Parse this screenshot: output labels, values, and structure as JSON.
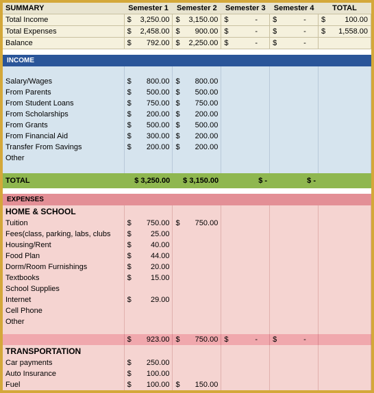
{
  "summary": {
    "title": "SUMMARY",
    "headers": [
      "Semester 1",
      "Semester 2",
      "Semester 3",
      "Semester 4",
      "TOTAL"
    ],
    "rows": [
      {
        "label": "Total Income",
        "s1": "3,250.00",
        "s2": "3,150.00",
        "s3": "-",
        "s4": "-",
        "total": "100.00"
      },
      {
        "label": "Total Expenses",
        "s1": "2,458.00",
        "s2": "900.00",
        "s3": "-",
        "s4": "-",
        "total": "1,558.00"
      },
      {
        "label": "Balance",
        "s1": "792.00",
        "s2": "2,250.00",
        "s3": "-",
        "s4": "-",
        "total": ""
      }
    ]
  },
  "income": {
    "title": "INCOME",
    "rows": [
      {
        "label": "Salary/Wages",
        "s1": "800.00",
        "s2": "800.00"
      },
      {
        "label": "From Parents",
        "s1": "500.00",
        "s2": "500.00"
      },
      {
        "label": "From Student Loans",
        "s1": "750.00",
        "s2": "750.00"
      },
      {
        "label": "From Scholarships",
        "s1": "200.00",
        "s2": "200.00"
      },
      {
        "label": "From Grants",
        "s1": "500.00",
        "s2": "500.00"
      },
      {
        "label": "From Financial Aid",
        "s1": "300.00",
        "s2": "200.00"
      },
      {
        "label": "Transfer From Savings",
        "s1": "200.00",
        "s2": "200.00"
      },
      {
        "label": "Other",
        "s1": "",
        "s2": ""
      }
    ],
    "total": {
      "label": "TOTAL",
      "s1": "$ 3,250.00",
      "s2": "$ 3,150.00",
      "s3": "$       -",
      "s4": "$       -"
    }
  },
  "expenses": {
    "title": "EXPENSES",
    "sections": [
      {
        "name": "HOME & SCHOOL",
        "rows": [
          {
            "label": "Tuition",
            "s1": "750.00",
            "s2": "750.00"
          },
          {
            "label": "Fees(class, parking, labs, clubs",
            "s1": "25.00",
            "s2": ""
          },
          {
            "label": "Housing/Rent",
            "s1": "40.00",
            "s2": ""
          },
          {
            "label": "Food Plan",
            "s1": "44.00",
            "s2": ""
          },
          {
            "label": "Dorm/Room Furnishings",
            "s1": "20.00",
            "s2": ""
          },
          {
            "label": "Textbooks",
            "s1": "15.00",
            "s2": ""
          },
          {
            "label": "School Supplies",
            "s1": "",
            "s2": ""
          },
          {
            "label": "Internet",
            "s1": "29.00",
            "s2": ""
          },
          {
            "label": "Cell Phone",
            "s1": "",
            "s2": ""
          },
          {
            "label": "Other",
            "s1": "",
            "s2": ""
          }
        ],
        "subtotal": {
          "s1": "923.00",
          "s2": "750.00",
          "s3": "-",
          "s4": "-"
        }
      },
      {
        "name": "TRANSPORTATION",
        "rows": [
          {
            "label": "Car payments",
            "s1": "250.00",
            "s2": ""
          },
          {
            "label": "Auto Insurance",
            "s1": "100.00",
            "s2": ""
          },
          {
            "label": "Fuel",
            "s1": "100.00",
            "s2": "150.00"
          }
        ]
      }
    ]
  },
  "chart_data": {
    "type": "table",
    "title": "College Semester Budget",
    "columns": [
      "Category",
      "Semester 1",
      "Semester 2",
      "Semester 3",
      "Semester 4",
      "TOTAL"
    ],
    "summary": [
      [
        "Total Income",
        3250.0,
        3150.0,
        0,
        0,
        100.0
      ],
      [
        "Total Expenses",
        2458.0,
        900.0,
        0,
        0,
        1558.0
      ],
      [
        "Balance",
        792.0,
        2250.0,
        0,
        0,
        null
      ]
    ],
    "income": [
      [
        "Salary/Wages",
        800.0,
        800.0
      ],
      [
        "From Parents",
        500.0,
        500.0
      ],
      [
        "From Student Loans",
        750.0,
        750.0
      ],
      [
        "From Scholarships",
        200.0,
        200.0
      ],
      [
        "From Grants",
        500.0,
        500.0
      ],
      [
        "From Financial Aid",
        300.0,
        200.0
      ],
      [
        "Transfer From Savings",
        200.0,
        200.0
      ],
      [
        "Other",
        null,
        null
      ]
    ],
    "income_total": [
      3250.0,
      3150.0,
      0,
      0
    ],
    "expenses_home_school": [
      [
        "Tuition",
        750.0,
        750.0
      ],
      [
        "Fees(class, parking, labs, clubs)",
        25.0,
        null
      ],
      [
        "Housing/Rent",
        40.0,
        null
      ],
      [
        "Food Plan",
        44.0,
        null
      ],
      [
        "Dorm/Room Furnishings",
        20.0,
        null
      ],
      [
        "Textbooks",
        15.0,
        null
      ],
      [
        "School Supplies",
        null,
        null
      ],
      [
        "Internet",
        29.0,
        null
      ],
      [
        "Cell Phone",
        null,
        null
      ],
      [
        "Other",
        null,
        null
      ]
    ],
    "expenses_home_school_subtotal": [
      923.0,
      750.0,
      0,
      0
    ],
    "expenses_transportation": [
      [
        "Car payments",
        250.0,
        null
      ],
      [
        "Auto Insurance",
        100.0,
        null
      ],
      [
        "Fuel",
        100.0,
        150.0
      ]
    ]
  }
}
